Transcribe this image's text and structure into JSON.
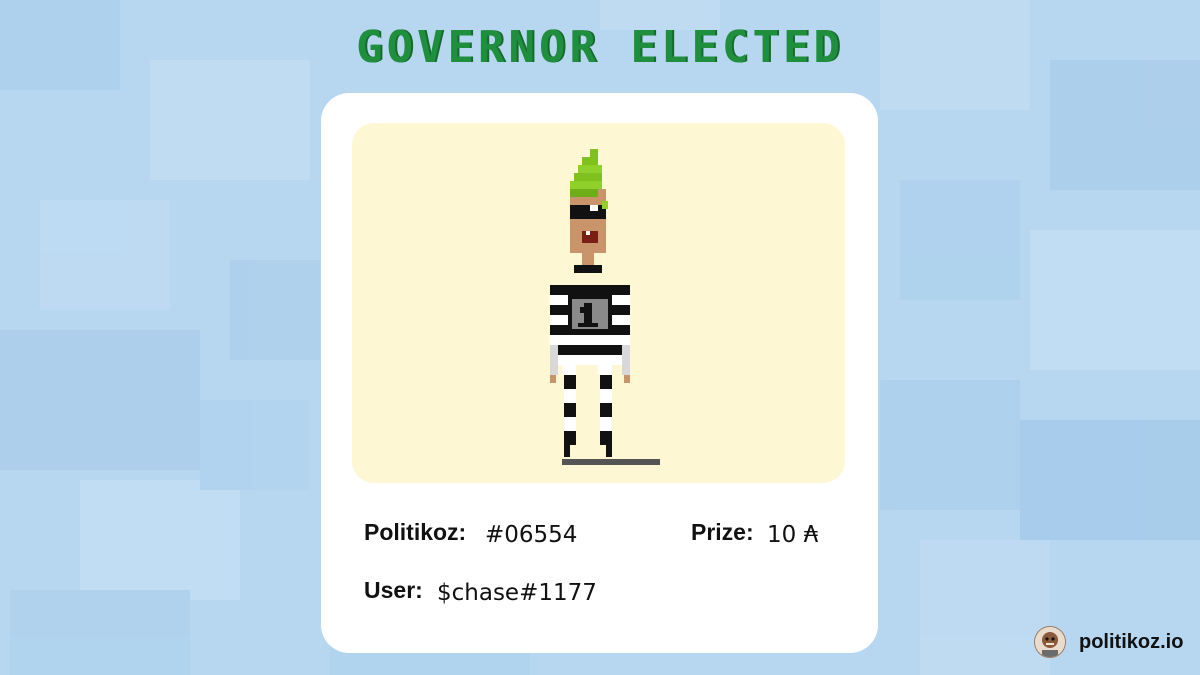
{
  "title": "GOVERNOR ELECTED",
  "card": {
    "politikoz_label": "Politikoz:",
    "politikoz_value": "#06554",
    "prize_label": "Prize:",
    "prize_value": "10 ₳",
    "user_label": "User:",
    "user_value": "$chase#1177"
  },
  "brand": {
    "site": "politikoz.io"
  },
  "colors": {
    "title": "#1f8f3e",
    "background": "#b7d7f1",
    "portrait_bg": "#fdf8d3"
  }
}
